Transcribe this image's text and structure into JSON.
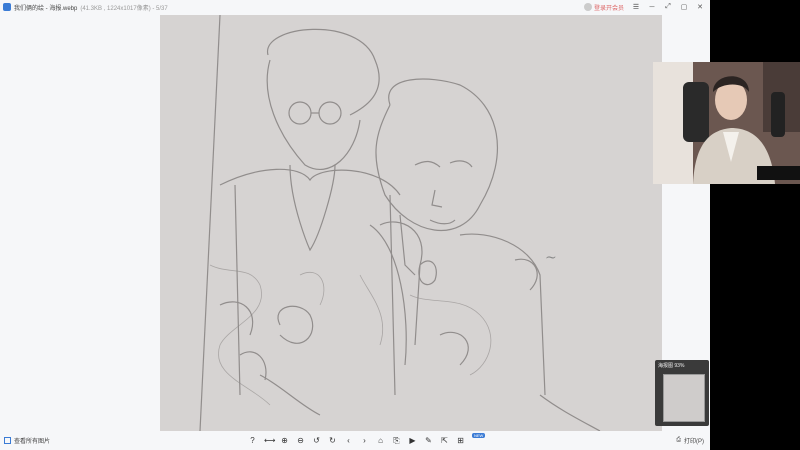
{
  "titlebar": {
    "title": "我们俩的绘 - 海报.webp",
    "meta": "(41.3KB , 1224x1017像素) - 5/37",
    "vip_label": "登录开会员",
    "buttons": [
      "☰",
      "─",
      "⤢",
      "▢",
      "✕"
    ]
  },
  "thumbnail": {
    "label": "海报图 93%"
  },
  "bottombar": {
    "view_all_label": "查看所有图片",
    "new_badge": "NEW",
    "print_label": "打印(P)",
    "tools": [
      "?",
      "⟷",
      "⊕",
      "⊖",
      "↺",
      "↻",
      "‹",
      "›",
      "⌂",
      "⎘",
      "▶",
      "✎",
      "⇱",
      "⊞"
    ]
  },
  "colors": {
    "accent": "#3a7bd5",
    "viewer_bg": "#f6f7f9",
    "paper": "#d6d3d2"
  }
}
